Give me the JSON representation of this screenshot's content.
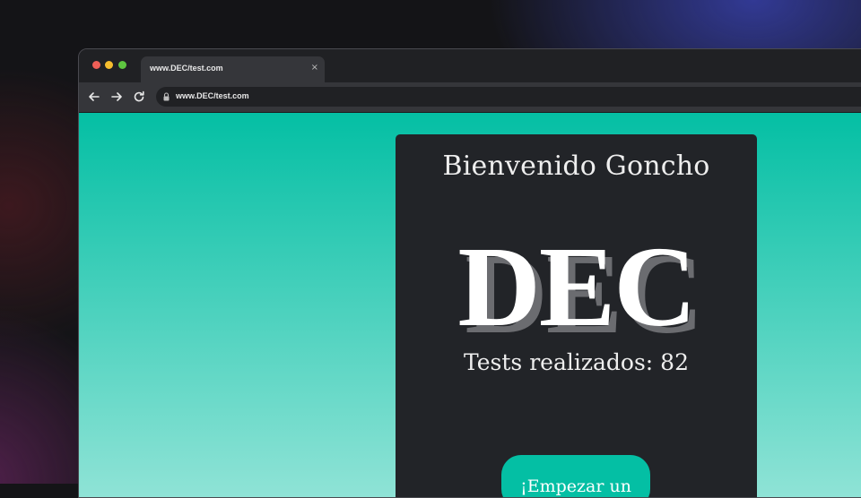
{
  "browser": {
    "tab_title": "www.DEC/test.com",
    "tab_close": "×",
    "url": "www.DEC/test.com",
    "icons": [
      "back-arrow-icon",
      "forward-arrow-icon",
      "reload-icon",
      "lock-icon",
      "close-icon"
    ]
  },
  "colors": {
    "page_gradient_top": "#04bfa4",
    "page_gradient_bottom": "#8fe3d6",
    "card_bg": "#222428",
    "button_bg": "#04bfa4"
  },
  "page": {
    "welcome": "Bienvenido Goncho",
    "logo": "DEC",
    "tests_label": "Tests realizados: 82",
    "start_button": "¡Empezar un"
  }
}
